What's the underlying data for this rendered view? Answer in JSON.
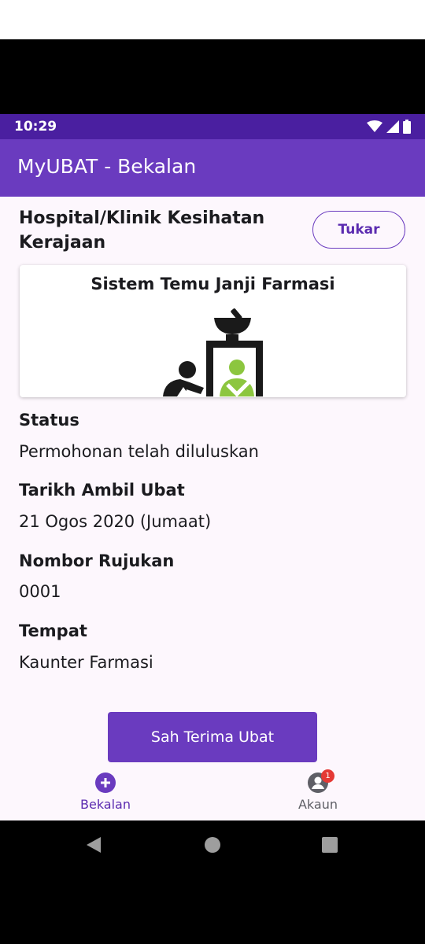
{
  "status_bar": {
    "time": "10:29",
    "icons": [
      "wifi-icon",
      "signal-icon",
      "battery-icon"
    ]
  },
  "app_bar": {
    "title": "MyUBAT - Bekalan"
  },
  "facility": {
    "name": "Hospital/Klinik Kesihatan Kerajaan",
    "change_label": "Tukar"
  },
  "banner": {
    "title": "Sistem Temu Janji Farmasi",
    "icon": "pharmacy-counter-illustration"
  },
  "details": {
    "status_label": "Status",
    "status_value": "Permohonan telah diluluskan",
    "date_label": "Tarikh Ambil Ubat",
    "date_value": "21 Ogos 2020 (Jumaat)",
    "reference_label": "Nombor Rujukan",
    "reference_value": "0001",
    "location_label": "Tempat",
    "location_value": "Kaunter Farmasi"
  },
  "actions": {
    "confirm_label": "Sah Terima Ubat"
  },
  "bottom_nav": {
    "items": [
      {
        "label": "Bekalan",
        "icon": "add-circle-icon",
        "selected": true
      },
      {
        "label": "Akaun",
        "icon": "account-icon",
        "badge": "1",
        "selected": false
      }
    ]
  },
  "colors": {
    "primary": "#6a3bbf",
    "status_bar": "#4a1fa0",
    "background": "#fdf7fd",
    "badge": "#e53935",
    "illustration_green": "#8cc63f"
  }
}
